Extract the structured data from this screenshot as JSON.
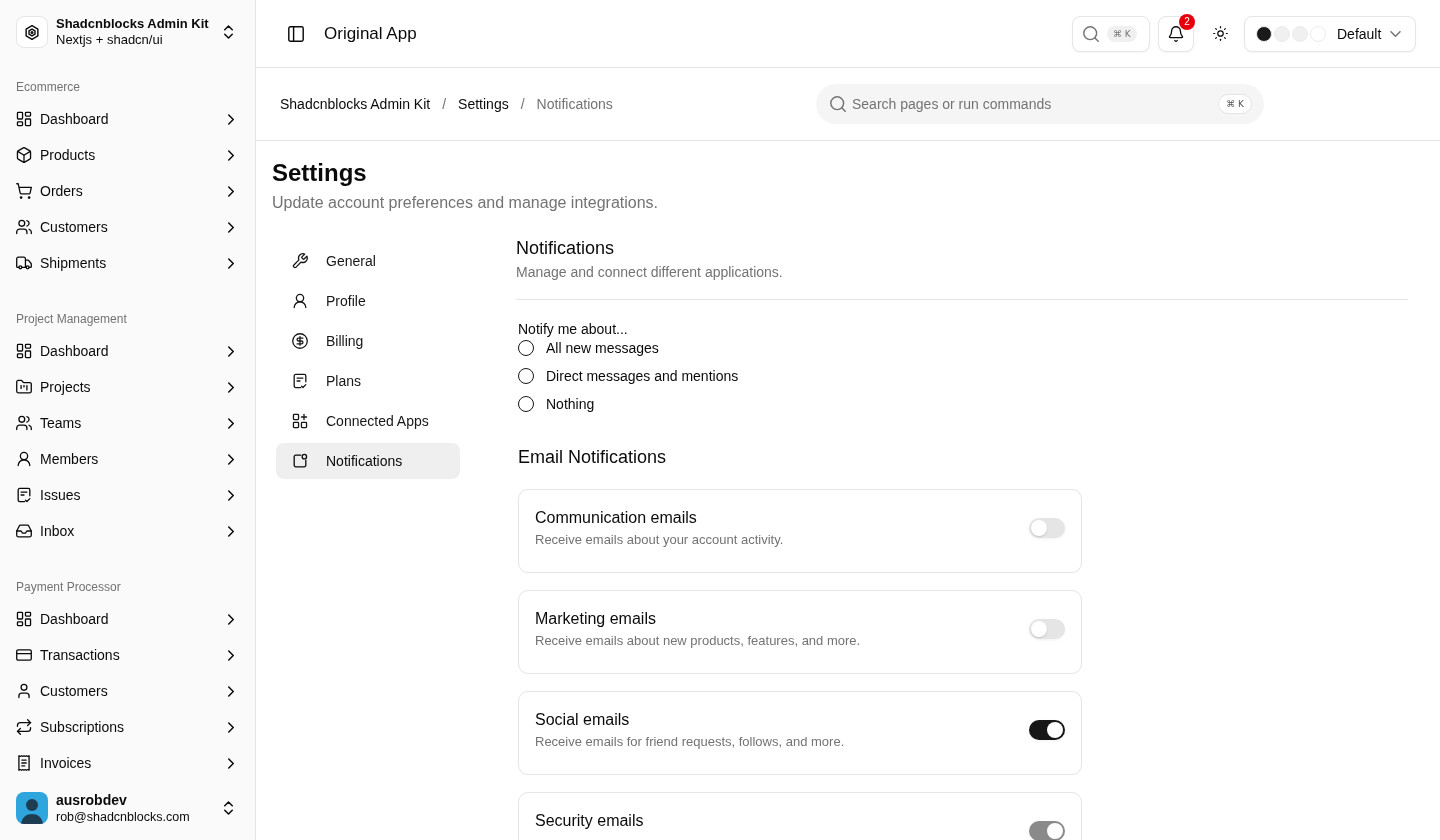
{
  "sidebar": {
    "brand": {
      "title": "Shadcnblocks Admin Kit",
      "subtitle": "Nextjs + shadcn/ui"
    },
    "groups": [
      {
        "label": "Ecommerce",
        "items": [
          {
            "label": "Dashboard",
            "expanded": false
          },
          {
            "label": "Products",
            "expanded": false
          },
          {
            "label": "Orders",
            "expanded": false
          },
          {
            "label": "Customers",
            "expanded": false
          },
          {
            "label": "Shipments",
            "expanded": false
          }
        ]
      },
      {
        "label": "Project Management",
        "items": [
          {
            "label": "Dashboard",
            "expanded": false
          },
          {
            "label": "Projects",
            "expanded": false
          },
          {
            "label": "Teams",
            "expanded": false
          },
          {
            "label": "Members",
            "expanded": false
          },
          {
            "label": "Issues",
            "expanded": false
          },
          {
            "label": "Inbox",
            "expanded": false
          }
        ]
      },
      {
        "label": "Payment Processor",
        "items": [
          {
            "label": "Dashboard",
            "expanded": false
          },
          {
            "label": "Transactions",
            "expanded": false
          },
          {
            "label": "Customers",
            "expanded": false
          },
          {
            "label": "Subscriptions",
            "expanded": false
          },
          {
            "label": "Invoices",
            "expanded": false
          }
        ]
      }
    ],
    "user": {
      "name": "ausrobdev",
      "email": "rob@shadcnblocks.com"
    }
  },
  "header": {
    "title": "Original App",
    "search_shortcut": "⌘ K",
    "notification_count": "2",
    "theme": {
      "swatches": [
        {
          "color": "#1a1a1a"
        },
        {
          "color": "#f0f0f0"
        },
        {
          "color": "#f0f0f0"
        },
        {
          "color": "#ffffff"
        }
      ],
      "label": "Default"
    }
  },
  "breadcrumb": [
    {
      "label": "Shadcnblocks Admin Kit",
      "kind": "link"
    },
    {
      "label": "/",
      "kind": "separator"
    },
    {
      "label": "Settings",
      "kind": "link"
    },
    {
      "label": "/",
      "kind": "separator"
    },
    {
      "label": "Notifications",
      "kind": "page"
    }
  ],
  "command_search": {
    "placeholder": "Search pages or run commands",
    "shortcut": "⌘ K"
  },
  "page": {
    "title": "Settings",
    "subtitle": "Update account preferences and manage integrations."
  },
  "settings_nav": [
    {
      "label": "General",
      "selected": false
    },
    {
      "label": "Profile",
      "selected": false
    },
    {
      "label": "Billing",
      "selected": false
    },
    {
      "label": "Plans",
      "selected": false
    },
    {
      "label": "Connected Apps",
      "selected": false
    },
    {
      "label": "Notifications",
      "selected": true
    }
  ],
  "section": {
    "title": "Notifications",
    "description": "Manage and connect different applications.",
    "notify": {
      "label": "Notify me about...",
      "options": [
        {
          "label": "All new messages",
          "selected": false
        },
        {
          "label": "Direct messages and mentions",
          "selected": false
        },
        {
          "label": "Nothing",
          "selected": false
        }
      ]
    },
    "email_title": "Email Notifications",
    "emails": [
      {
        "title": "Communication emails",
        "description": "Receive emails about your account activity.",
        "on": false,
        "disabled": false
      },
      {
        "title": "Marketing emails",
        "description": "Receive emails about new products, features, and more.",
        "on": false,
        "disabled": false
      },
      {
        "title": "Social emails",
        "description": "Receive emails for friend requests, follows, and more.",
        "on": true,
        "disabled": false
      },
      {
        "title": "Security emails",
        "on": true,
        "disabled": true
      }
    ]
  }
}
